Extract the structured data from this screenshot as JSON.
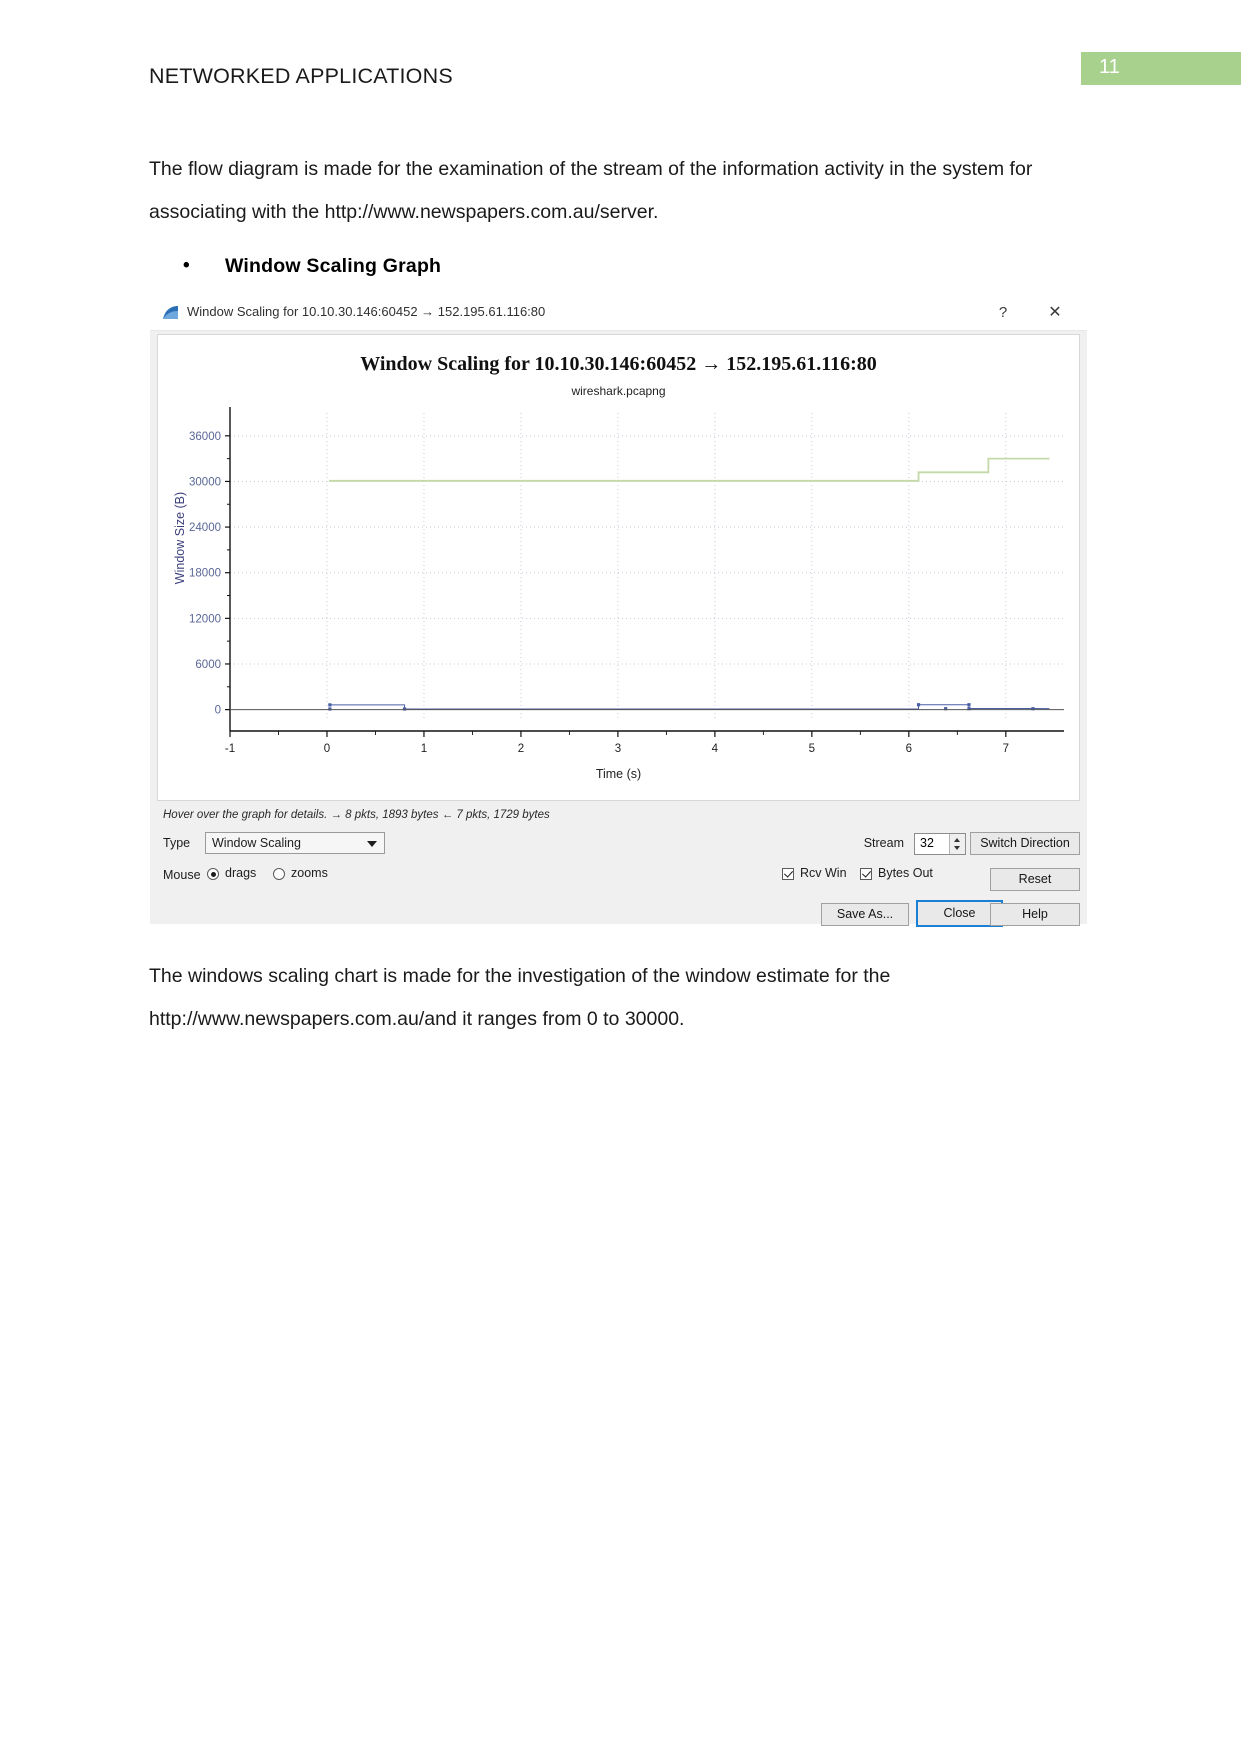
{
  "document": {
    "header_title": "NETWORKED APPLICATIONS",
    "page_number": "11",
    "accent_color": "#a9d18e",
    "paragraph_1": "The flow diagram is made for the examination of the stream of the information activity in the system for associating with the http://www.newspapers.com.au/server.",
    "bullet": {
      "marker": "•",
      "label": "Window Scaling Graph"
    },
    "paragraph_2": "The windows scaling chart is made for the investigation of the window estimate for the http://www.newspapers.com.au/and it ranges from 0 to 30000."
  },
  "window": {
    "title": "Window Scaling for 10.10.30.146:60452 → 152.195.61.116:80",
    "app_icon": "wireshark-fin-icon",
    "help_glyph": "?",
    "close_glyph": "✕"
  },
  "chart_data": {
    "type": "line",
    "title": "Window Scaling for 10.10.30.146:60452 → 152.195.61.116:80",
    "subtitle": "wireshark.pcapng",
    "xlabel": "Time (s)",
    "ylabel": "Window Size (B)",
    "xlim": [
      -1,
      7.6
    ],
    "ylim": [
      -1500,
      39000
    ],
    "xticks": [
      "-1",
      "0",
      "1",
      "2",
      "3",
      "4",
      "5",
      "6",
      "7"
    ],
    "xtick_values": [
      -1,
      0,
      1,
      2,
      3,
      4,
      5,
      6,
      7
    ],
    "yticks": [
      "0",
      "6000",
      "12000",
      "18000",
      "24000",
      "30000",
      "36000"
    ],
    "ytick_values": [
      0,
      6000,
      12000,
      18000,
      24000,
      30000,
      36000
    ],
    "grid": true,
    "legend": "none",
    "series": [
      {
        "name": "Rcv Win",
        "color": "#c4d9a8",
        "style": "step",
        "points": [
          [
            0.02,
            30080
          ],
          [
            6.1,
            30080
          ],
          [
            6.1,
            31200
          ],
          [
            6.82,
            31200
          ],
          [
            6.82,
            33000
          ],
          [
            7.45,
            33000
          ]
        ]
      },
      {
        "name": "Bytes Out",
        "color": "#4a5fa5",
        "style": "step-with-markers",
        "points": [
          [
            0.03,
            620
          ],
          [
            0.8,
            620
          ],
          [
            0.8,
            80
          ],
          [
            6.1,
            80
          ],
          [
            6.1,
            640
          ],
          [
            6.62,
            640
          ],
          [
            6.62,
            150
          ],
          [
            7.28,
            150
          ],
          [
            7.45,
            120
          ]
        ],
        "markers": [
          [
            0.03,
            620
          ],
          [
            0.03,
            80
          ],
          [
            0.8,
            80
          ],
          [
            6.1,
            640
          ],
          [
            6.38,
            120
          ],
          [
            6.62,
            640
          ],
          [
            6.62,
            120
          ],
          [
            7.28,
            120
          ]
        ]
      }
    ]
  },
  "controls": {
    "hint": "Hover over the graph for details. → 8 pkts, 1893 bytes ← 7 pkts, 1729 bytes",
    "type_label": "Type",
    "type_value": "Window Scaling",
    "mouse_label": "Mouse",
    "mouse_options": [
      {
        "label": "drags",
        "selected": true
      },
      {
        "label": "zooms",
        "selected": false
      }
    ],
    "checkboxes": [
      {
        "label": "Rcv Win",
        "checked": true
      },
      {
        "label": "Bytes Out",
        "checked": true
      }
    ],
    "stream_label": "Stream",
    "stream_value": "32",
    "switch_direction_label": "Switch Direction",
    "reset_label": "Reset",
    "save_as_label": "Save As...",
    "close_label": "Close",
    "help_label": "Help"
  }
}
